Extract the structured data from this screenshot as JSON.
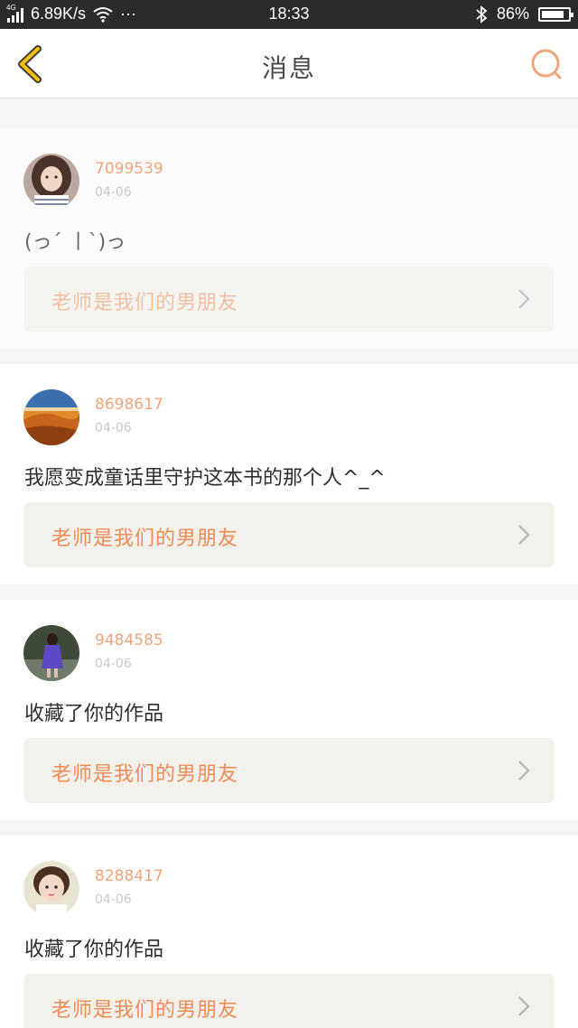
{
  "status_bar": {
    "network": "4G",
    "speed": "6.89K/s",
    "more": "···",
    "time": "18:33",
    "battery": "86%",
    "battery_level": 0.86
  },
  "header": {
    "title": "消息"
  },
  "colors": {
    "accent": "#ee8c57",
    "back_icon": "#f2c200",
    "search_icon": "#f0a57a",
    "username": "#f0a57a"
  },
  "messages": [
    {
      "username": "7099539",
      "date": "04-06",
      "text": "(っ´ 丨`)っ",
      "link": "老师是我们的男朋友"
    },
    {
      "username": "8698617",
      "date": "04-06",
      "text": "我愿变成童话里守护这本书的那个人^_^",
      "link": "老师是我们的男朋友"
    },
    {
      "username": "9484585",
      "date": "04-06",
      "text": "收藏了你的作品",
      "link": "老师是我们的男朋友"
    },
    {
      "username": "8288417",
      "date": "04-06",
      "text": "收藏了你的作品",
      "link": "老师是我们的男朋友"
    }
  ]
}
